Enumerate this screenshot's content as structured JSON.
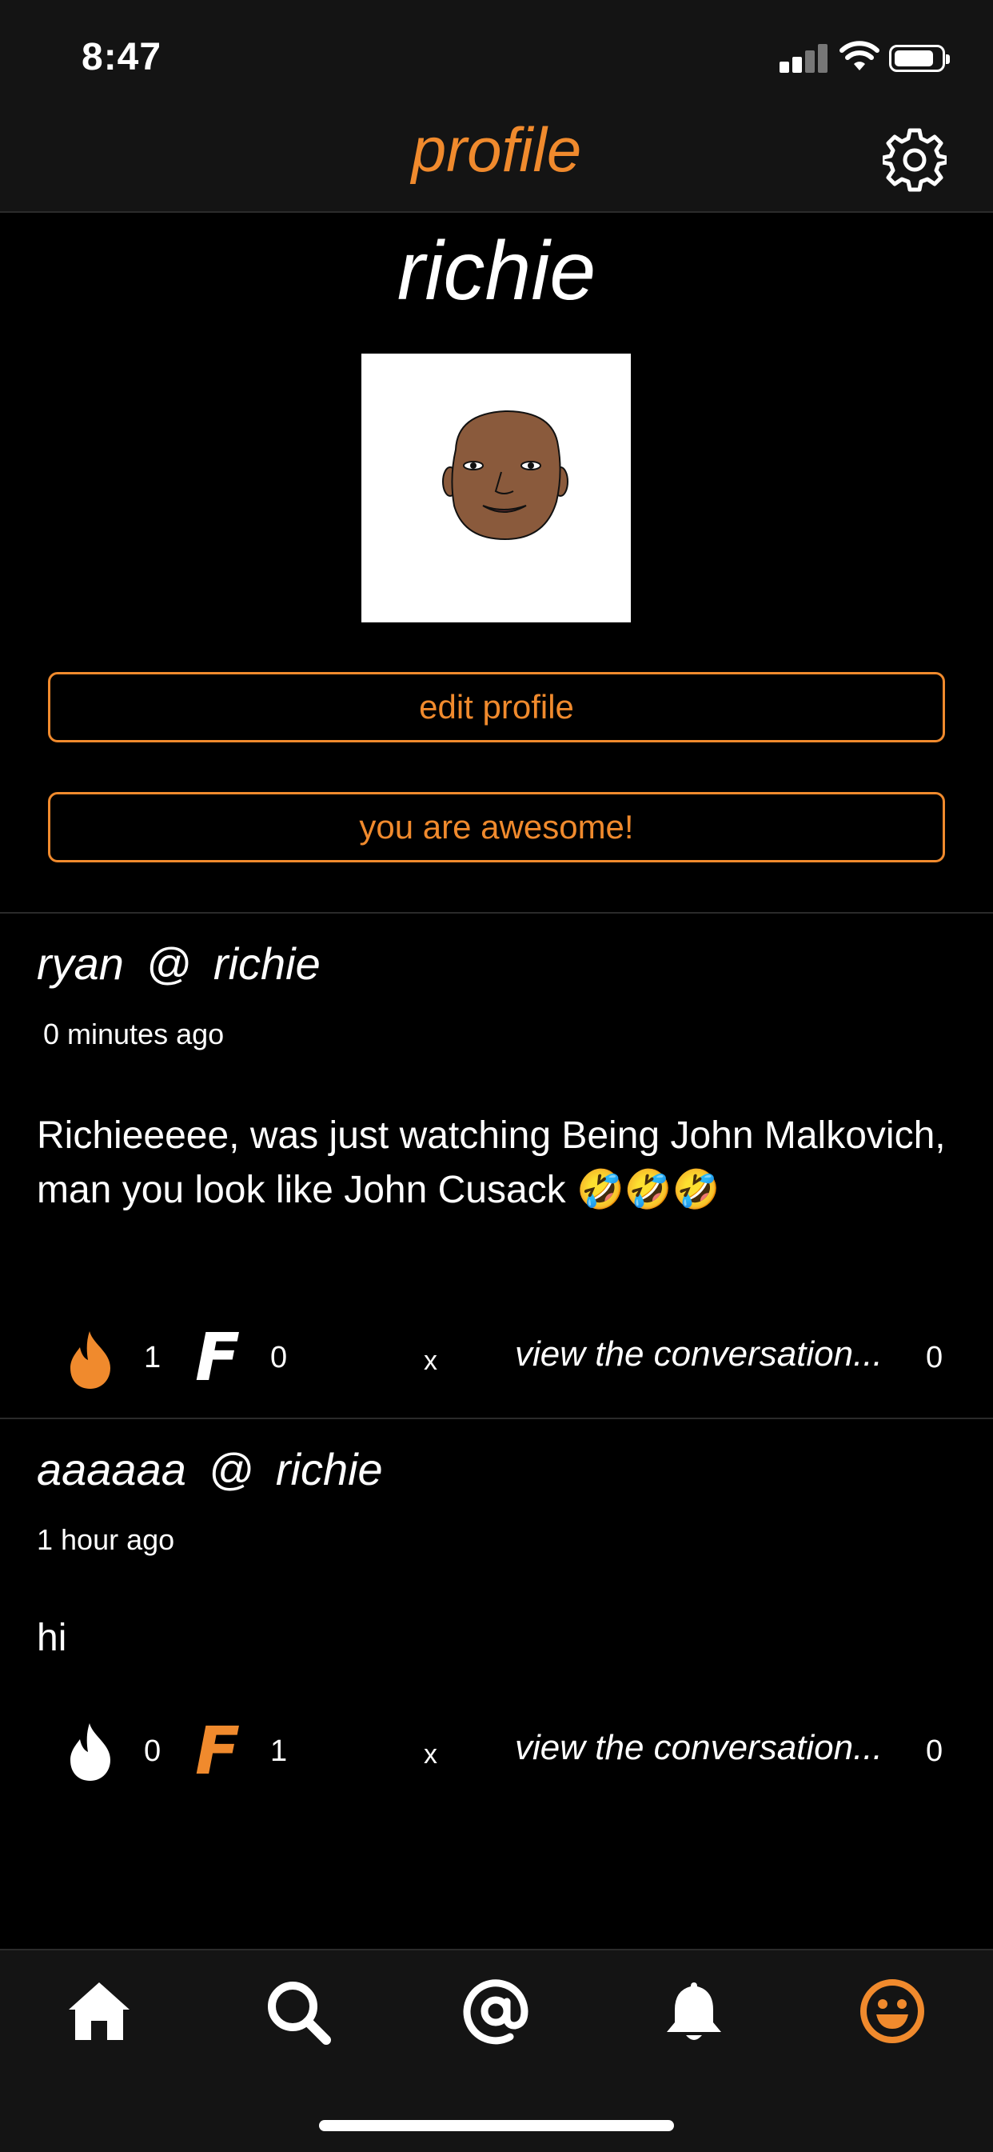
{
  "status_bar": {
    "time": "8:47"
  },
  "header": {
    "title": "profile"
  },
  "profile": {
    "username": "richie",
    "edit_button": "edit profile",
    "compliment_button": "you are awesome!"
  },
  "posts": [
    {
      "author": "ryan",
      "at": "@",
      "recipient": "richie",
      "time": "0 minutes ago",
      "body": "Richieeeee, was just watching Being John Malkovich, man you look like John Cusack 🤣🤣🤣",
      "fire_count": "1",
      "f_count": "0",
      "close": "x",
      "conversation_link": "view the conversation...",
      "reply_count": "0",
      "fire_active": true,
      "f_active": false
    },
    {
      "author": "aaaaaa",
      "at": "@",
      "recipient": "richie",
      "time": "1 hour ago",
      "body": "hi",
      "fire_count": "0",
      "f_count": "1",
      "close": "x",
      "conversation_link": "view the conversation...",
      "reply_count": "0",
      "fire_active": false,
      "f_active": true
    }
  ],
  "colors": {
    "accent": "#f08a2d",
    "background": "#000000",
    "bar": "#141414"
  },
  "tab_bar": {
    "items": [
      {
        "icon": "home-icon",
        "active": false
      },
      {
        "icon": "search-icon",
        "active": false
      },
      {
        "icon": "at-sign-icon",
        "active": false
      },
      {
        "icon": "bell-icon",
        "active": false
      },
      {
        "icon": "smiley-profile-icon",
        "active": true
      }
    ]
  }
}
